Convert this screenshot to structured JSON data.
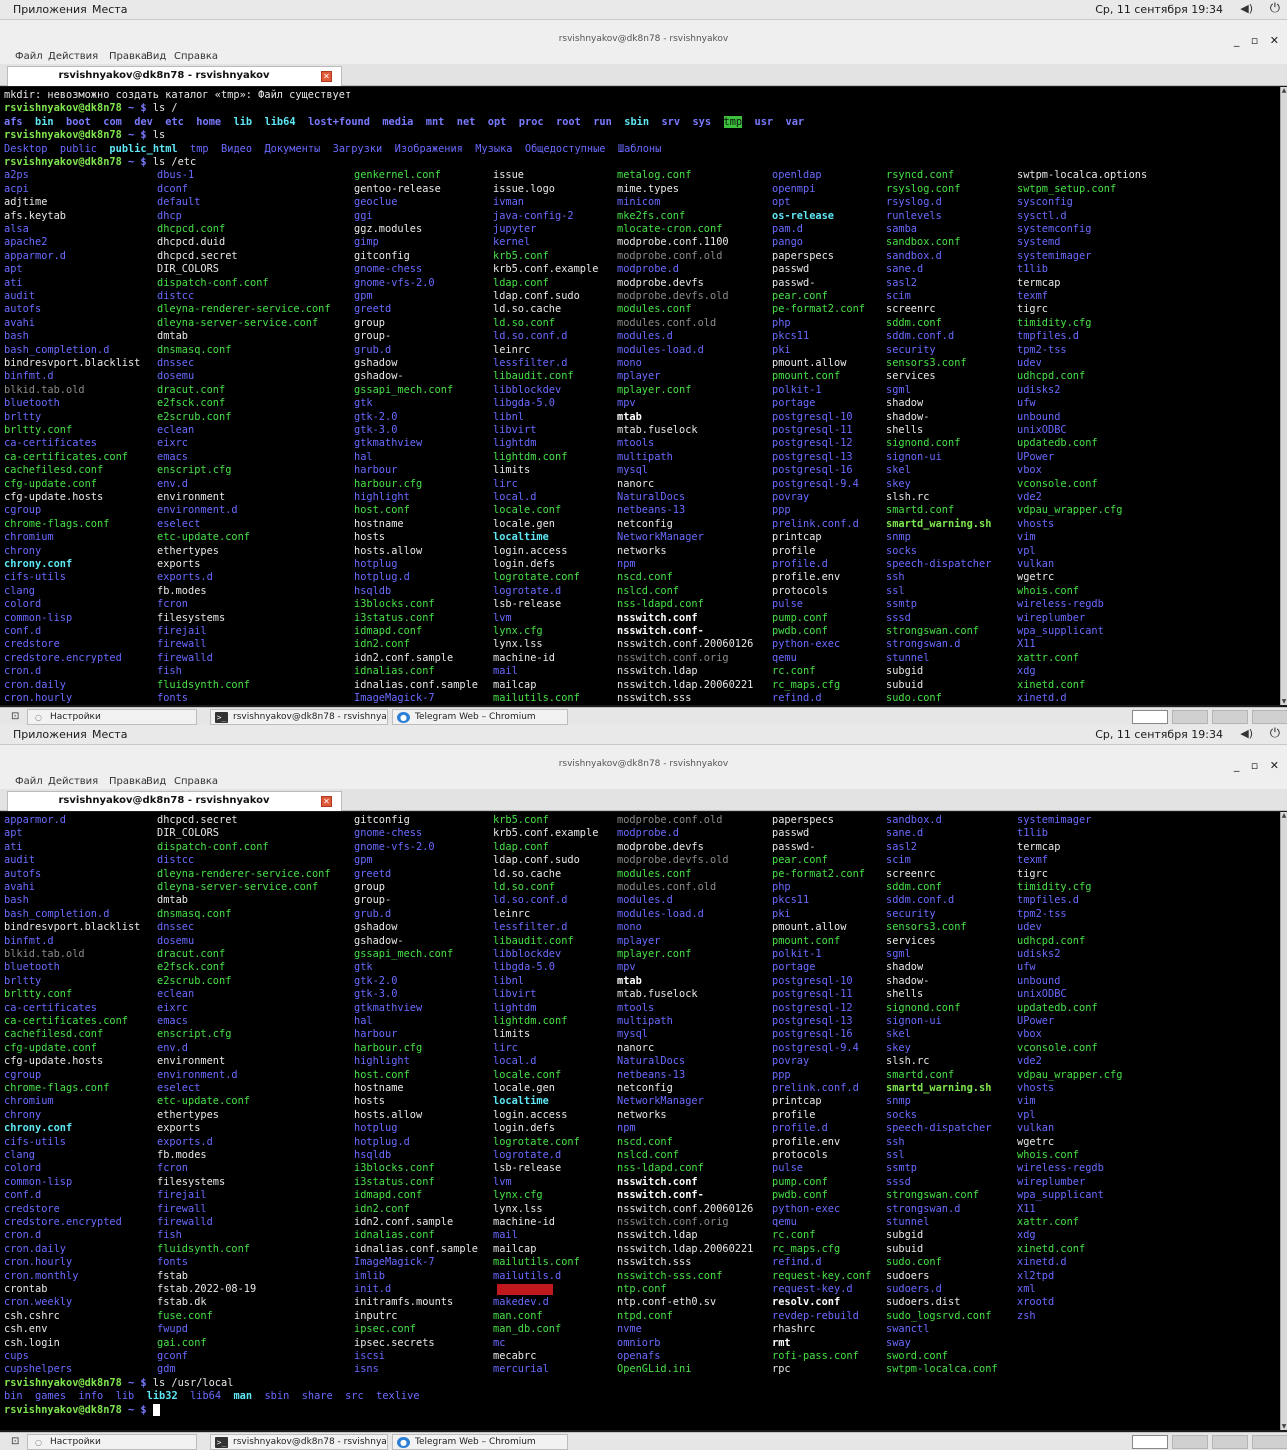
{
  "panel": {
    "apps": "Приложения",
    "places": "Места",
    "clock": "Ср, 11 сентября 19:34",
    "volume_icon": "speaker-icon",
    "power_icon": "power-icon"
  },
  "window": {
    "title": "rsvishnyakov@dk8n78 - rsvishnyakov",
    "controls": "_ ▫ ✕"
  },
  "menu": {
    "file": "Файл",
    "actions": "Действия",
    "edit": "Правка",
    "view": "Вид",
    "help": "Справка"
  },
  "tab": {
    "label": "rsvishnyakov@dk8n78 - rsvishnyakov",
    "close": "✕"
  },
  "taskbar": {
    "settings": "Настройки",
    "terminal": "rsvishnyakov@dk8n78 - rsvishnya...",
    "browser": "Telegram Web – Chromium"
  },
  "prompt": {
    "user": "rsvishnyakov@dk8n78",
    "tail": " ~ $ "
  },
  "screen0": {
    "lines": [
      {
        "segs": [
          {
            "t": "mkdir: невозможно создать каталог «tmp»: Файл существует",
            "c": "t"
          }
        ]
      },
      {
        "prompt": true,
        "cmd": "ls /"
      },
      {
        "segs": [
          {
            "t": "afs",
            "c": "dirb"
          },
          {
            "t": "  ",
            "c": "t"
          },
          {
            "t": "bin",
            "c": "cb"
          },
          {
            "t": "  ",
            "c": "t"
          },
          {
            "t": "boot",
            "c": "dirb"
          },
          {
            "t": "  ",
            "c": "t"
          },
          {
            "t": "com",
            "c": "dirb"
          },
          {
            "t": "  ",
            "c": "t"
          },
          {
            "t": "dev",
            "c": "dirb"
          },
          {
            "t": "  ",
            "c": "t"
          },
          {
            "t": "etc",
            "c": "dirb"
          },
          {
            "t": "  ",
            "c": "t"
          },
          {
            "t": "home",
            "c": "dirb"
          },
          {
            "t": "  ",
            "c": "t"
          },
          {
            "t": "lib",
            "c": "cb"
          },
          {
            "t": "  ",
            "c": "t"
          },
          {
            "t": "lib64",
            "c": "cb"
          },
          {
            "t": "  ",
            "c": "t"
          },
          {
            "t": "lost+found",
            "c": "dirb"
          },
          {
            "t": "  ",
            "c": "t"
          },
          {
            "t": "media",
            "c": "dirb"
          },
          {
            "t": "  ",
            "c": "t"
          },
          {
            "t": "mnt",
            "c": "dirb"
          },
          {
            "t": "  ",
            "c": "t"
          },
          {
            "t": "net",
            "c": "dirb"
          },
          {
            "t": "  ",
            "c": "t"
          },
          {
            "t": "opt",
            "c": "dirb"
          },
          {
            "t": "  ",
            "c": "t"
          },
          {
            "t": "proc",
            "c": "dirb"
          },
          {
            "t": "  ",
            "c": "t"
          },
          {
            "t": "root",
            "c": "dirb"
          },
          {
            "t": "  ",
            "c": "t"
          },
          {
            "t": "run",
            "c": "dirb"
          },
          {
            "t": "  ",
            "c": "t"
          },
          {
            "t": "sbin",
            "c": "cb"
          },
          {
            "t": "  ",
            "c": "t"
          },
          {
            "t": "srv",
            "c": "dirb"
          },
          {
            "t": "  ",
            "c": "t"
          },
          {
            "t": "sys",
            "c": "dirb"
          },
          {
            "t": "  ",
            "c": "t"
          },
          {
            "t": "tmp",
            "c": "tmp"
          },
          {
            "t": "  ",
            "c": "t"
          },
          {
            "t": "usr",
            "c": "dirb"
          },
          {
            "t": "  ",
            "c": "t"
          },
          {
            "t": "var",
            "c": "dirb"
          }
        ]
      },
      {
        "prompt": true,
        "cmd": "ls"
      },
      {
        "segs": [
          {
            "t": "Desktop",
            "c": "dir"
          },
          {
            "t": "  ",
            "c": "t"
          },
          {
            "t": "public",
            "c": "dir"
          },
          {
            "t": "  ",
            "c": "t"
          },
          {
            "t": "public_html",
            "c": "cb"
          },
          {
            "t": "  ",
            "c": "t"
          },
          {
            "t": "tmp",
            "c": "dir"
          },
          {
            "t": "  ",
            "c": "t"
          },
          {
            "t": "Видео",
            "c": "dir"
          },
          {
            "t": "  ",
            "c": "t"
          },
          {
            "t": "Документы",
            "c": "dir"
          },
          {
            "t": "  ",
            "c": "t"
          },
          {
            "t": "Загрузки",
            "c": "dir"
          },
          {
            "t": "  ",
            "c": "t"
          },
          {
            "t": "Изображения",
            "c": "dir"
          },
          {
            "t": "  ",
            "c": "t"
          },
          {
            "t": "Музыка",
            "c": "dir"
          },
          {
            "t": "  ",
            "c": "t"
          },
          {
            "t": "Общедоступные",
            "c": "dir"
          },
          {
            "t": "  ",
            "c": "t"
          },
          {
            "t": "Шаблоны",
            "c": "dir"
          }
        ]
      },
      {
        "prompt": true,
        "cmd": "ls /etc"
      }
    ],
    "start_row": 0
  },
  "screen1": {
    "tail_lines": [
      {
        "prompt": true,
        "cmd": "ls /usr/local"
      },
      {
        "segs": [
          {
            "t": "bin",
            "c": "dir"
          },
          {
            "t": "  ",
            "c": "t"
          },
          {
            "t": "games",
            "c": "dir"
          },
          {
            "t": "  ",
            "c": "t"
          },
          {
            "t": "info",
            "c": "dir"
          },
          {
            "t": "  ",
            "c": "t"
          },
          {
            "t": "lib",
            "c": "dir"
          },
          {
            "t": "  ",
            "c": "t"
          },
          {
            "t": "lib32",
            "c": "cb"
          },
          {
            "t": "  ",
            "c": "t"
          },
          {
            "t": "lib64",
            "c": "dir"
          },
          {
            "t": "  ",
            "c": "t"
          },
          {
            "t": "man",
            "c": "cb"
          },
          {
            "t": "  ",
            "c": "t"
          },
          {
            "t": "sbin",
            "c": "dir"
          },
          {
            "t": "  ",
            "c": "t"
          },
          {
            "t": "share",
            "c": "dir"
          },
          {
            "t": "  ",
            "c": "t"
          },
          {
            "t": "src",
            "c": "dir"
          },
          {
            "t": "  ",
            "c": "t"
          },
          {
            "t": "texlive",
            "c": "dir"
          }
        ]
      },
      {
        "prompt": true,
        "cmd": "",
        "cursor": true
      }
    ]
  },
  "etc_columns": [
    [
      "a2ps:d",
      "acpi:d",
      "adjtime:w",
      "afs.keytab:w",
      "alsa:d",
      "apache2:d",
      "apparmor.d:d",
      "apt:d",
      "ati:d",
      "audit:d",
      "autofs:d",
      "avahi:d",
      "bash:d",
      "bash_completion.d:d",
      "bindresvport.blacklist:w",
      "binfmt.d:d",
      "blkid.tab.old:g",
      "bluetooth:d",
      "brltty:d",
      "brltty.conf:e",
      "ca-certificates:d",
      "ca-certificates.conf:e",
      "cachefilesd.conf:e",
      "cfg-update.conf:e",
      "cfg-update.hosts:w",
      "cgroup:d",
      "chrome-flags.conf:e",
      "chromium:d",
      "chrony:d",
      "chrony.conf:cb",
      "cifs-utils:d",
      "clang:d",
      "colord:d",
      "common-lisp:d",
      "conf.d:d",
      "credstore:d",
      "credstore.encrypted:d",
      "cron.d:d",
      "cron.daily:d",
      "cron.hourly:d",
      "cron.monthly:d",
      "crontab:w",
      "cron.weekly:d",
      "csh.cshrc:w",
      "csh.env:w",
      "csh.login:w",
      "cups:d",
      "cupshelpers:d"
    ],
    [
      "dbus-1:d",
      "dconf:d",
      "default:d",
      "dhcp:d",
      "dhcpcd.conf:e",
      "dhcpcd.duid:w",
      "dhcpcd.secret:w",
      "DIR_COLORS:w",
      "dispatch-conf.conf:e",
      "distcc:d",
      "dleyna-renderer-service.conf:e",
      "dleyna-server-service.conf:e",
      "dmtab:w",
      "dnsmasq.conf:e",
      "dnssec:d",
      "dosemu:d",
      "dracut.conf:e",
      "e2fsck.conf:e",
      "e2scrub.conf:e",
      "eclean:d",
      "eixrc:d",
      "emacs:d",
      "enscript.cfg:e",
      "env.d:d",
      "environment:w",
      "environment.d:d",
      "eselect:d",
      "etc-update.conf:e",
      "ethertypes:w",
      "exports:w",
      "exports.d:d",
      "fb.modes:w",
      "fcron:d",
      "filesystems:w",
      "firejail:d",
      "firewall:d",
      "firewalld:d",
      "fish:d",
      "fluidsynth.conf:e",
      "fonts:d",
      "fstab:w",
      "fstab.2022-08-19:w",
      "fstab.dk:w",
      "fuse.conf:e",
      "fwupd:d",
      "gai.conf:e",
      "gconf:d",
      "gdm:d"
    ],
    [
      "genkernel.conf:e",
      "gentoo-release:w",
      "geoclue:d",
      "ggi:d",
      "ggz.modules:w",
      "gimp:d",
      "gitconfig:w",
      "gnome-chess:d",
      "gnome-vfs-2.0:d",
      "gpm:d",
      "greetd:d",
      "group:w",
      "group-:w",
      "grub.d:d",
      "gshadow:w",
      "gshadow-:w",
      "gssapi_mech.conf:e",
      "gtk:d",
      "gtk-2.0:d",
      "gtk-3.0:d",
      "gtkmathview:d",
      "hal:d",
      "harbour:d",
      "harbour.cfg:e",
      "highlight:d",
      "host.conf:e",
      "hostname:w",
      "hosts:w",
      "hosts.allow:w",
      "hotplug:d",
      "hotplug.d:d",
      "hsqldb:d",
      "i3blocks.conf:e",
      "i3status.conf:e",
      "idmapd.conf:e",
      "idn2.conf:e",
      "idn2.conf.sample:w",
      "idnalias.conf:e",
      "idnalias.conf.sample:w",
      "ImageMagick-7:d",
      "imlib:d",
      "init.d:d",
      "initramfs.mounts:w",
      "inputrc:w",
      "ipsec.conf:e",
      "ipsec.secrets:w",
      "iscsi:d",
      "isns:d"
    ],
    [
      "issue:w",
      "issue.logo:w",
      "ivman:d",
      "java-config-2:d",
      "jupyter:d",
      "kernel:d",
      "krb5.conf:e",
      "krb5.conf.example:w",
      "ldap.conf:e",
      "ldap.conf.sudo:w",
      "ld.so.cache:w",
      "ld.so.conf:e",
      "ld.so.conf.d:d",
      "leinrc:w",
      "lessfilter.d:d",
      "libaudit.conf:e",
      "libblockdev:d",
      "libgda-5.0:d",
      "libnl:d",
      "libvirt:d",
      "lightdm:d",
      "lightdm.conf:e",
      "limits:w",
      "lirc:d",
      "local.d:d",
      "locale.conf:e",
      "locale.gen:w",
      "localtime:cb",
      "login.access:w",
      "login.defs:w",
      "logrotate.conf:e",
      "logrotate.d:d",
      "lsb-release:w",
      "lvm:d",
      "lynx.cfg:e",
      "lynx.lss:w",
      "machine-id:w",
      "mail:d",
      "mailcap:w",
      "mailutils.conf:e",
      "mailutils.d:d",
      "__red__:r",
      "makedev.d:d",
      "man.conf:e",
      "man_db.conf:e",
      "mc:d",
      "mecabrc:w",
      "mercurial:d"
    ],
    [
      "metalog.conf:e",
      "mime.types:w",
      "minicom:d",
      "mke2fs.conf:e",
      "mlocate-cron.conf:e",
      "modprobe.conf.1100:w",
      "modprobe.conf.old:g",
      "modprobe.d:d",
      "modprobe.devfs:w",
      "modprobe.devfs.old:g",
      "modules.conf:e",
      "modules.conf.old:g",
      "modules.d:d",
      "modules-load.d:d",
      "mono:d",
      "mplayer:d",
      "mplayer.conf:e",
      "mpv:d",
      "mtab:wb",
      "mtab.fuselock:w",
      "mtools:d",
      "multipath:d",
      "mysql:d",
      "nanorc:w",
      "NaturalDocs:d",
      "netbeans-13:d",
      "netconfig:w",
      "NetworkManager:d",
      "networks:w",
      "npm:d",
      "nscd.conf:e",
      "nslcd.conf:e",
      "nss-ldapd.conf:e",
      "nsswitch.conf:wb",
      "nsswitch.conf-:wb",
      "nsswitch.conf.20060126:w",
      "nsswitch.conf.orig:g",
      "nsswitch.ldap:w",
      "nsswitch.ldap.20060221:w",
      "nsswitch.sss:w",
      "nsswitch-sss.conf:e",
      "ntp.conf:e",
      "ntp.conf-eth0.sv:w",
      "ntpd.conf:e",
      "nvme:d",
      "omniorb:d",
      "openafs:d",
      "OpenGLid.ini:e"
    ],
    [
      "openldap:d",
      "openmpi:d",
      "opt:d",
      "os-release:cb",
      "pam.d:d",
      "pango:d",
      "paperspecs:w",
      "passwd:w",
      "passwd-:w",
      "pear.conf:e",
      "pe-format2.conf:e",
      "php:d",
      "pkcs11:d",
      "pki:d",
      "pmount.allow:w",
      "pmount.conf:e",
      "polkit-1:d",
      "portage:d",
      "postgresql-10:d",
      "postgresql-11:d",
      "postgresql-12:d",
      "postgresql-13:d",
      "postgresql-16:d",
      "postgresql-9.4:d",
      "povray:d",
      "ppp:d",
      "prelink.conf.d:d",
      "printcap:w",
      "profile:w",
      "profile.d:d",
      "profile.env:w",
      "protocols:w",
      "pulse:d",
      "pump.conf:e",
      "pwdb.conf:e",
      "python-exec:d",
      "qemu:d",
      "rc.conf:e",
      "rc_maps.cfg:e",
      "refind.d:d",
      "request-key.conf:e",
      "request-key.d:d",
      "resolv.conf:wb",
      "revdep-rebuild:d",
      "rhashrc:w",
      "rmt:wb",
      "rofi-pass.conf:e",
      "rpc:w"
    ],
    [
      "rsyncd.conf:e",
      "rsyslog.conf:e",
      "rsyslog.d:d",
      "runlevels:d",
      "samba:d",
      "sandbox.conf:e",
      "sandbox.d:d",
      "sane.d:d",
      "sasl2:d",
      "scim:d",
      "screenrc:w",
      "sddm.conf:e",
      "sddm.conf.d:d",
      "security:d",
      "sensors3.conf:e",
      "services:w",
      "sgml:d",
      "shadow:w",
      "shadow-:w",
      "shells:w",
      "signond.conf:e",
      "signon-ui:d",
      "skel:d",
      "skey:d",
      "slsh.rc:w",
      "smartd.conf:e",
      "smartd_warning.sh:ub",
      "snmp:d",
      "socks:d",
      "speech-dispatcher:d",
      "ssh:d",
      "ssl:d",
      "ssmtp:d",
      "sssd:d",
      "strongswan.conf:e",
      "strongswan.d:d",
      "stunnel:d",
      "subgid:w",
      "subuid:w",
      "sudo.conf:e",
      "sudoers:w",
      "sudoers.d:d",
      "sudoers.dist:w",
      "sudo_logsrvd.conf:e",
      "swanctl:d",
      "sway:d",
      "sword.conf:e",
      "swtpm-localca.conf:e"
    ],
    [
      "swtpm-localca.options:w",
      "swtpm_setup.conf:e",
      "sysconfig:d",
      "sysctl.d:d",
      "systemconfig:d",
      "systemd:d",
      "systemimager:d",
      "t1lib:d",
      "termcap:w",
      "texmf:d",
      "tigrc:w",
      "timidity.cfg:e",
      "tmpfiles.d:d",
      "tpm2-tss:d",
      "udev:d",
      "udhcpd.conf:e",
      "udisks2:d",
      "ufw:d",
      "unbound:d",
      "unixODBC:d",
      "updatedb.conf:e",
      "UPower:d",
      "vbox:d",
      "vconsole.conf:e",
      "vde2:d",
      "vdpau_wrapper.cfg:e",
      "vhosts:d",
      "vim:d",
      "vpl:d",
      "vulkan:d",
      "wgetrc:w",
      "whois.conf:e",
      "wireless-regdb:d",
      "wireplumber:d",
      "wpa_supplicant:d",
      "X11:d",
      "xattr.conf:e",
      "xdg:d",
      "xinetd.conf:e",
      "xinetd.d:d",
      "xl2tpd:d",
      "xml:d",
      "xrootd:d",
      "zsh:d"
    ]
  ]
}
